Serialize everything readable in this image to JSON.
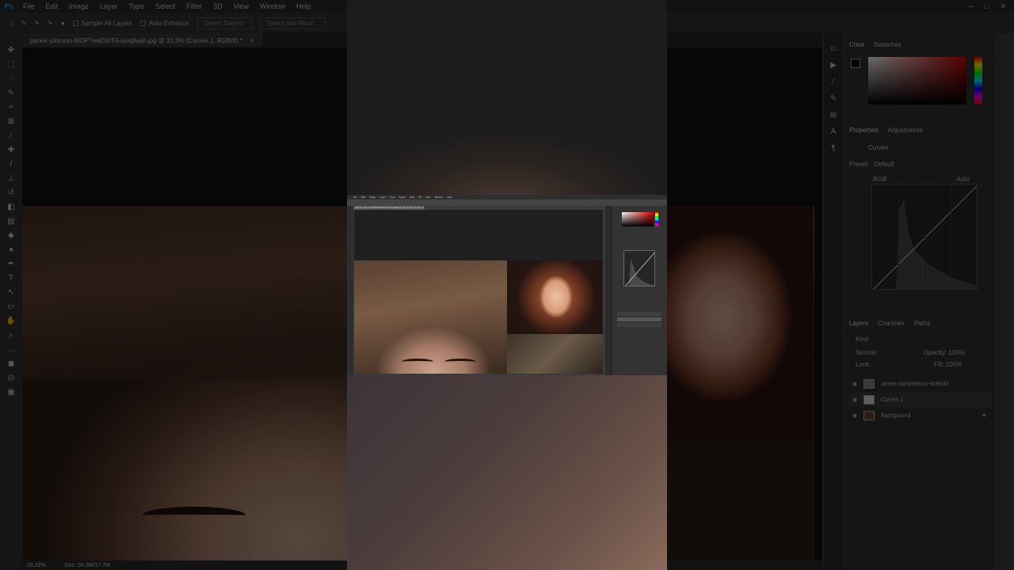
{
  "menu": {
    "items": [
      "File",
      "Edit",
      "Image",
      "Layer",
      "Type",
      "Select",
      "Filter",
      "3D",
      "View",
      "Window",
      "Help"
    ],
    "window_controls": [
      "─",
      "□",
      "✕"
    ]
  },
  "options_bar": {
    "sample_all_layers": "Sample All Layers",
    "auto_enhance": "Auto-Enhance",
    "select_subject": "Select Subject",
    "select_and_mask": "Select and Mask..."
  },
  "document": {
    "tab_title": "parker-johnson-MOP7ewDXITA-unsplash.jpg @ 33.3% (Curves 1, RGB/8) *",
    "close": "×"
  },
  "status": {
    "zoom": "33.33%",
    "doc": "Doc: 56.3M/17.7M"
  },
  "panels": {
    "color_tabs": [
      "Color",
      "Swatches"
    ],
    "properties_tabs": [
      "Properties",
      "Adjustments"
    ],
    "properties_title": "Curves",
    "preset_label": "Preset:",
    "preset_value": "Default",
    "channel": "RGB",
    "auto": "Auto",
    "layers_tabs": [
      "Layers",
      "Channels",
      "Paths"
    ],
    "kind": "Kind",
    "mode": "Normal",
    "opacity": "Opacity: 100%",
    "lock": "Lock:",
    "fill": "Fill: 100%",
    "layers": [
      {
        "name": "pexels-darshtheory-609633"
      },
      {
        "name": "Curves 1"
      },
      {
        "name": "Background"
      }
    ]
  },
  "colors": {
    "accent": "#31a8ff",
    "fg": "#000000",
    "bg": "#ffffff"
  }
}
